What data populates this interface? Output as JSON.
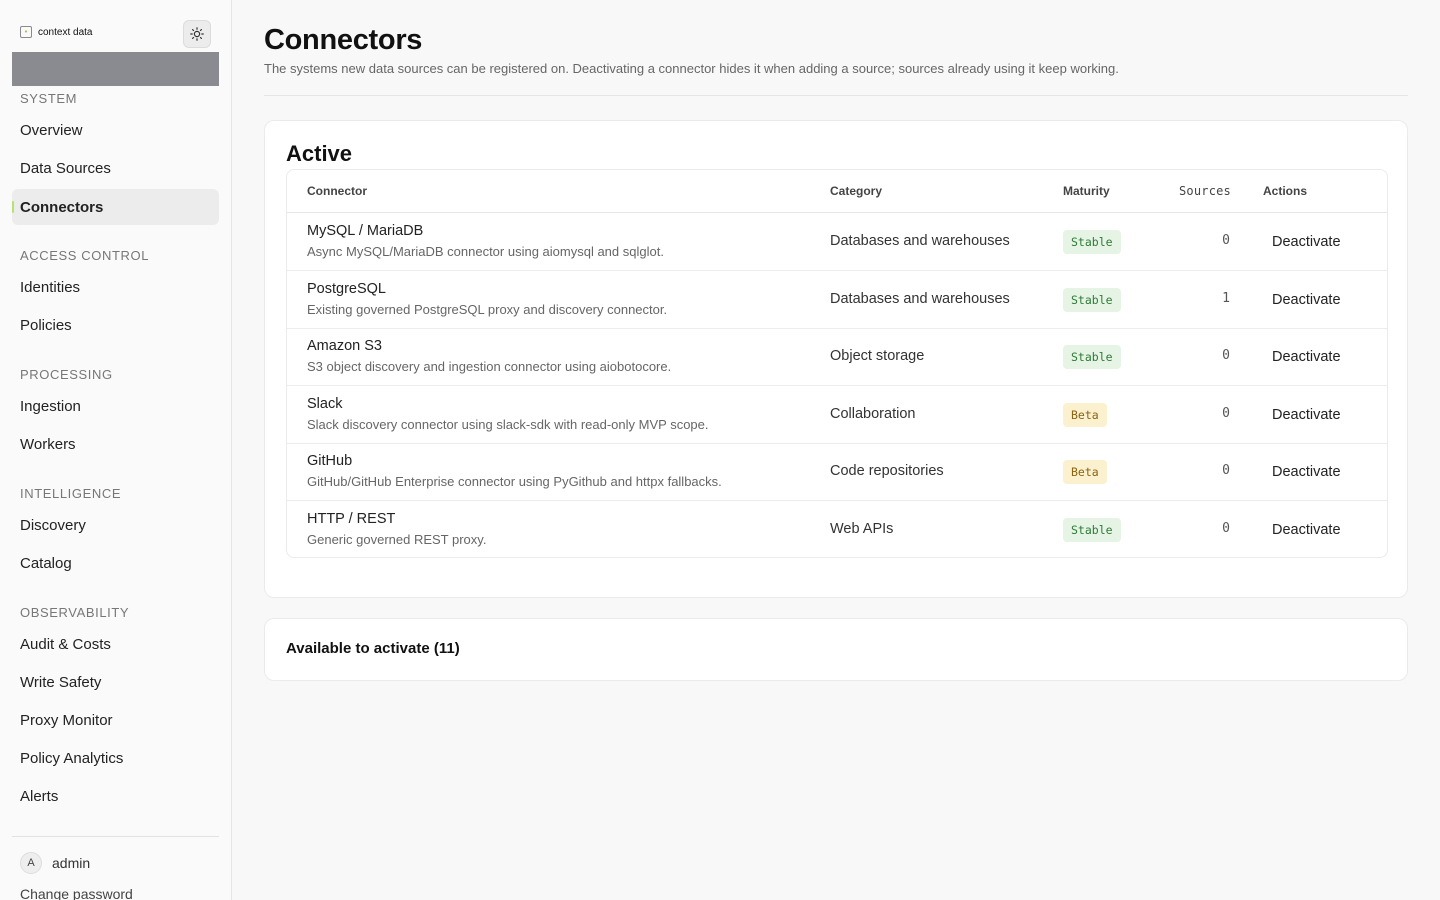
{
  "brand": {
    "name": "context data",
    "mark": "[•]"
  },
  "nav": {
    "sections": [
      {
        "title": "SYSTEM",
        "items": [
          "Overview",
          "Data Sources",
          "Connectors"
        ]
      },
      {
        "title": "ACCESS CONTROL",
        "items": [
          "Identities",
          "Policies"
        ]
      },
      {
        "title": "PROCESSING",
        "items": [
          "Ingestion",
          "Workers"
        ]
      },
      {
        "title": "INTELLIGENCE",
        "items": [
          "Discovery",
          "Catalog"
        ]
      },
      {
        "title": "OBSERVABILITY",
        "items": [
          "Audit & Costs",
          "Write Safety",
          "Proxy Monitor",
          "Policy Analytics",
          "Alerts"
        ]
      }
    ],
    "active": "Connectors"
  },
  "user": {
    "initial": "A",
    "name": "admin",
    "change_password": "Change password"
  },
  "page": {
    "title": "Connectors",
    "subtitle": "The systems new data sources can be registered on. Deactivating a connector hides it when adding a source; sources already using it keep working."
  },
  "active_card": {
    "title": "Active",
    "columns": {
      "connector": "Connector",
      "category": "Category",
      "maturity": "Maturity",
      "sources": "Sources",
      "actions": "Actions"
    },
    "rows": [
      {
        "name": "MySQL / MariaDB",
        "desc": "Async MySQL/MariaDB connector using aiomysql and sqlglot.",
        "category": "Databases and warehouses",
        "maturity": "Stable",
        "sources": "0",
        "action": "Deactivate"
      },
      {
        "name": "PostgreSQL",
        "desc": "Existing governed PostgreSQL proxy and discovery connector.",
        "category": "Databases and warehouses",
        "maturity": "Stable",
        "sources": "1",
        "action": "Deactivate"
      },
      {
        "name": "Amazon S3",
        "desc": "S3 object discovery and ingestion connector using aiobotocore.",
        "category": "Object storage",
        "maturity": "Stable",
        "sources": "0",
        "action": "Deactivate"
      },
      {
        "name": "Slack",
        "desc": "Slack discovery connector using slack-sdk with read-only MVP scope.",
        "category": "Collaboration",
        "maturity": "Beta",
        "sources": "0",
        "action": "Deactivate"
      },
      {
        "name": "GitHub",
        "desc": "GitHub/GitHub Enterprise connector using PyGithub and httpx fallbacks.",
        "category": "Code repositories",
        "maturity": "Beta",
        "sources": "0",
        "action": "Deactivate"
      },
      {
        "name": "HTTP / REST",
        "desc": "Generic governed REST proxy.",
        "category": "Web APIs",
        "maturity": "Stable",
        "sources": "0",
        "action": "Deactivate"
      }
    ]
  },
  "available_card": {
    "title": "Available to activate (11)"
  },
  "colors": {
    "accent": "#b6e36b",
    "stable_bg": "#e6f4e6",
    "stable_fg": "#2f7a35",
    "beta_bg": "#fbf1cf",
    "beta_fg": "#8a6412"
  }
}
